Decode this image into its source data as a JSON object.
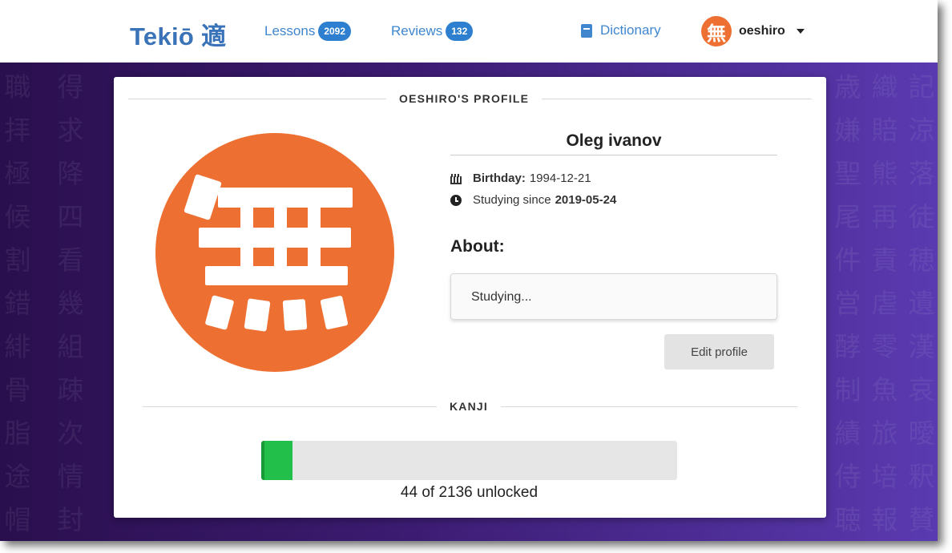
{
  "nav": {
    "brand": "Tekiō 適",
    "lessons_label": "Lessons",
    "lessons_count": "2092",
    "reviews_label": "Reviews",
    "reviews_count": "132",
    "dictionary_label": "Dictionary",
    "avatar_glyph": "無",
    "username": "oeshiro"
  },
  "background_kanji": [
    "職得",
    "拝求",
    "極降",
    "候四",
    "割看",
    "錯幾",
    "緋組",
    "骨疎",
    "脂次",
    "途情",
    "帽封",
    "歳織記",
    "嫌賠涼",
    "聖熊落",
    "尾再徒",
    "件責穂",
    "営虐遺",
    "酵零漢",
    "制魚哀",
    "績旅曖",
    "侍培釈",
    "聴報賛"
  ],
  "profile": {
    "section_title": "OESHIRO'S PROFILE",
    "avatar_glyph": "無",
    "name": "Oleg ivanov",
    "birthday_label": "Birthday:",
    "birthday_value": "1994-12-21",
    "studying_label": "Studying since",
    "studying_value": "2019-05-24",
    "about_label": "About:",
    "about_text": "Studying...",
    "edit_button": "Edit profile"
  },
  "kanji": {
    "section_title": "KANJI",
    "unlocked": 44,
    "total": 2136,
    "progress_text": "44 of 2136 unlocked"
  },
  "colors": {
    "brand": "#3a73b8",
    "avatar": "#ed7032",
    "progress": "#22c04a",
    "badge": "#2e7fcf"
  }
}
